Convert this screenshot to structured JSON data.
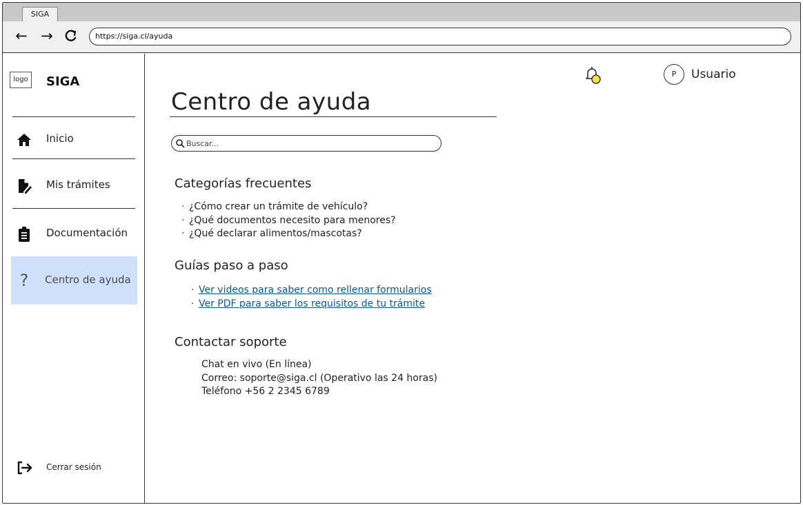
{
  "browser": {
    "tab_title": "SIGA",
    "url": "https://siga.cl/ayuda"
  },
  "sidebar": {
    "logo_text": "logo",
    "brand": "SIGA",
    "items": [
      {
        "label": "Inicio",
        "icon": "home-icon"
      },
      {
        "label": "Mis trámites",
        "icon": "file-edit-icon"
      },
      {
        "label": "Documentación",
        "icon": "clipboard-list-icon"
      },
      {
        "label": "Centro de ayuda",
        "icon": "question-mark-icon",
        "active": true
      }
    ],
    "logout_label": "Cerrar sesión",
    "active_color": "#cfe1fa"
  },
  "header": {
    "avatar_initial": "P",
    "username": "Usuario",
    "notification_icon": "bell-icon",
    "notification_dot_color": "#f5e04a"
  },
  "main": {
    "title": "Centro de ayuda",
    "search_placeholder": "Buscar...",
    "categories": {
      "heading": "Categorías frecuentes",
      "items": [
        "¿Cómo crear un trámite de vehículo?",
        "¿Qué documentos necesito para menores?",
        "¿Qué declarar alimentos/mascotas?"
      ]
    },
    "guides": {
      "heading": "Guías paso a paso",
      "items": [
        "Ver videos para saber como rellenar formularios",
        "Ver PDF para saber los requisitos de tu trámite"
      ],
      "link_color": "#0b57a6"
    },
    "support": {
      "heading": "Contactar soporte",
      "lines": [
        "Chat en vivo (En línea)",
        "Correo: soporte@siga.cl (Operativo las 24 horas)",
        "Teléfono +56 2 2345 6789"
      ]
    }
  }
}
